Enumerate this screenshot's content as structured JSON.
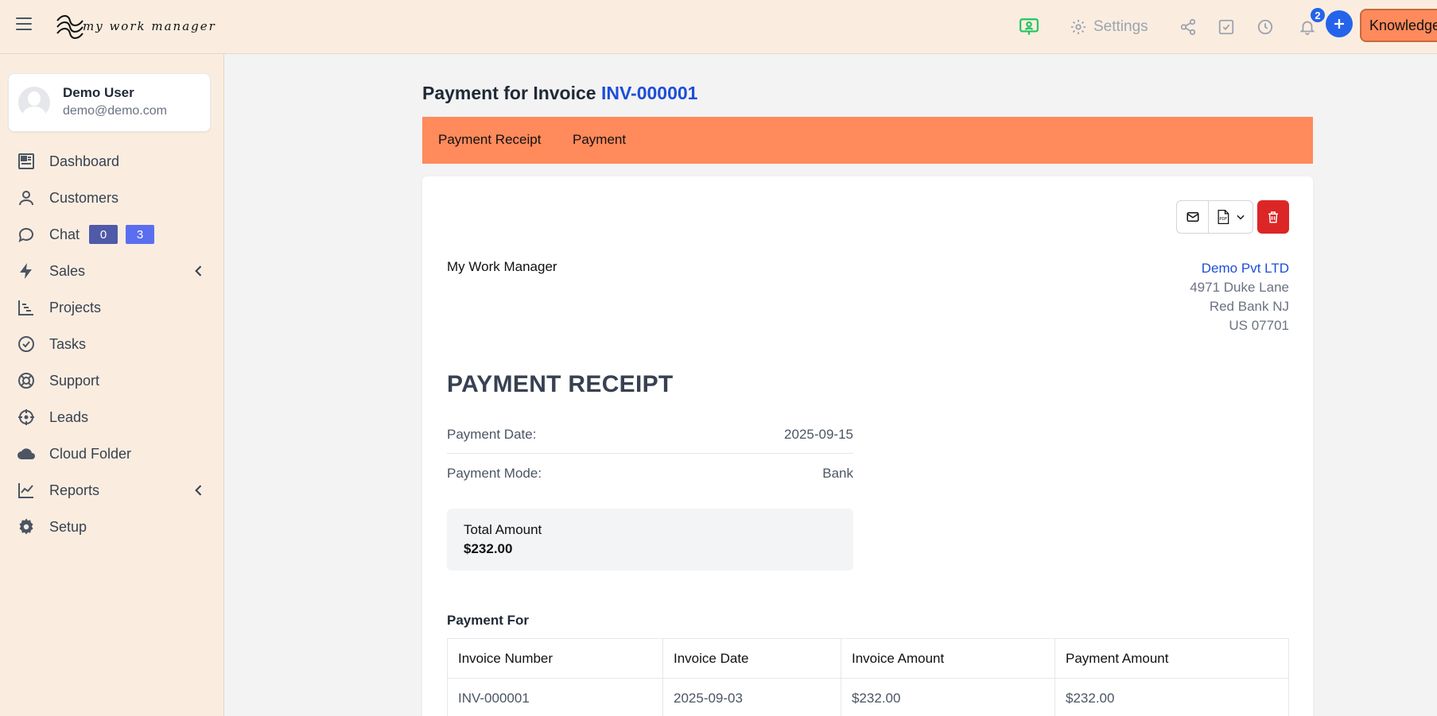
{
  "header": {
    "logo_text": "my work manager",
    "settings_label": "Settings",
    "notification_count": "2",
    "knowledge_label": "Knowledge Base",
    "accent": "#ff8a5c"
  },
  "sidebar": {
    "user": {
      "name": "Demo User",
      "email": "demo@demo.com"
    },
    "items": [
      {
        "label": "Dashboard",
        "icon": "dashboard-icon"
      },
      {
        "label": "Customers",
        "icon": "user-icon"
      },
      {
        "label": "Chat",
        "icon": "chat-icon",
        "badges": [
          "0",
          "3"
        ]
      },
      {
        "label": "Sales",
        "icon": "bolt-icon",
        "has_submenu": true
      },
      {
        "label": "Projects",
        "icon": "gantt-icon"
      },
      {
        "label": "Tasks",
        "icon": "check-circle-icon"
      },
      {
        "label": "Support",
        "icon": "lifebuoy-icon"
      },
      {
        "label": "Leads",
        "icon": "crosshair-icon"
      },
      {
        "label": "Cloud Folder",
        "icon": "cloud-icon"
      },
      {
        "label": "Reports",
        "icon": "line-chart-icon",
        "has_submenu": true
      },
      {
        "label": "Setup",
        "icon": "gear-icon"
      }
    ]
  },
  "main": {
    "title_prefix": "Payment for Invoice",
    "invoice_number": "INV-000001",
    "tabs": [
      "Payment Receipt",
      "Payment"
    ],
    "company_name": "My Work Manager",
    "client": {
      "name": "Demo Pvt LTD",
      "address1": "4971 Duke Lane",
      "address2": "Red Bank NJ",
      "address3": "US 07701"
    },
    "receipt_title": "PAYMENT RECEIPT",
    "payment_date_label": "Payment Date:",
    "payment_date": "2025-09-15",
    "payment_mode_label": "Payment Mode:",
    "payment_mode": "Bank",
    "total_label": "Total Amount",
    "total_value": "$232.00",
    "payment_for_label": "Payment For",
    "table": {
      "headers": [
        "Invoice Number",
        "Invoice Date",
        "Invoice Amount",
        "Payment Amount"
      ],
      "rows": [
        [
          "INV-000001",
          "2025-09-03",
          "$232.00",
          "$232.00"
        ]
      ]
    }
  }
}
